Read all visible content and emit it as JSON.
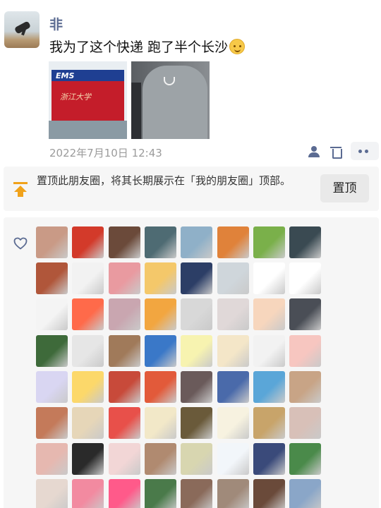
{
  "post": {
    "username": "非",
    "text": "我为了这个快递 跑了半个长沙",
    "emoji_icon": "smiling-face-icon",
    "photo1": {
      "brand": "EMS",
      "caption": "浙江大学"
    },
    "timestamp": "2022年7月10日 12:43",
    "action_icons": [
      "person-icon",
      "trash-icon",
      "more-icon"
    ]
  },
  "pin_card": {
    "icon": "pin-to-top-icon",
    "text": "置顶此朋友圈，将其长期展示在「我的朋友圈」顶部。",
    "button_label": "置顶"
  },
  "likes": {
    "icon": "heart-icon",
    "avatar_colors": [
      "#c99a86",
      "#d33a2a",
      "#6b4a3a",
      "#4e6b73",
      "#8fb0c8",
      "#e0823a",
      "#7ab04a",
      "#3a4a52",
      "#b0563a",
      "#f2f2f2",
      "#e99aa0",
      "#f4c86a",
      "#2c3e66",
      "#cfd6db",
      "#ffffff",
      "#ffffff",
      "#f4f4f4",
      "#ff6a4a",
      "#c9a6b0",
      "#f2a640",
      "#d8d8d8",
      "#e0d8d8",
      "#f7d6bd",
      "#4a4e56",
      "#3e6a3a",
      "#e6e6e6",
      "#a07a5a",
      "#3a78c8",
      "#f7f3b0",
      "#f4e6c8",
      "#f2f2f2",
      "#f7c6c0",
      "#d9d6f2",
      "#fcd86a",
      "#c84a3a",
      "#e25a3a",
      "#6a5a5a",
      "#4a6aaa",
      "#5aa6d8",
      "#c8a486",
      "#c47a5a",
      "#e6d6b8",
      "#e8504a",
      "#f2e8c8",
      "#6a5a3a",
      "#f7f2e0",
      "#c8a46a",
      "#d8c0b8",
      "#e6b8b0",
      "#2a2a2a",
      "#f2d6d6",
      "#b08a70",
      "#d8d6b0",
      "#f2f6fa",
      "#3a4a7a",
      "#4a8a4a",
      "#e6d8d0",
      "#f28aa0",
      "#ff5a8a",
      "#4a7a4a",
      "#8a6a5a",
      "#a08a7a",
      "#6a4a3a",
      "#8aa6c8"
    ]
  }
}
